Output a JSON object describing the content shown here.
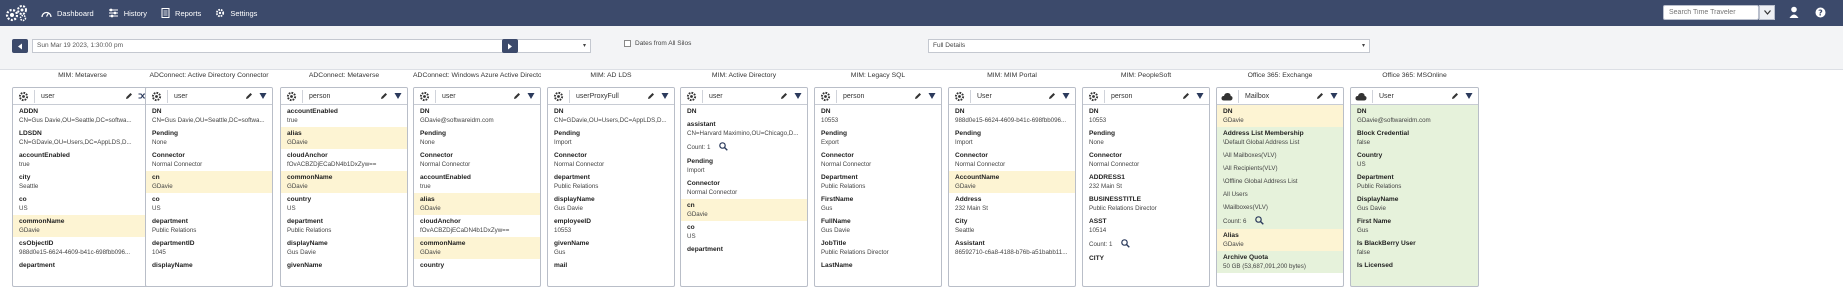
{
  "nav": {
    "dashboard": "Dashboard",
    "history": "History",
    "reports": "Reports",
    "settings": "Settings"
  },
  "search": {
    "placeholder": "Search Time Traveler"
  },
  "toolbar": {
    "date": "Sun Mar 19 2023, 1:30:00 pm",
    "dates_from_all_silos": "Dates from All Silos",
    "details_option": "Full Details"
  },
  "columns": [
    {
      "title": "MIM: Metaverse",
      "type": "user",
      "icon": "gear-icon",
      "attrs": [
        {
          "n": "ADDN",
          "v": "CN=Gus Davie,OU=Seattle,DC=softwa...",
          "hl": ""
        },
        {
          "n": "LDSDN",
          "v": "CN=GDavie,OU=Users,DC=AppLDS,D...",
          "hl": ""
        },
        {
          "n": "accountEnabled",
          "v": "true",
          "hl": ""
        },
        {
          "n": "city",
          "v": "Seattle",
          "hl": ""
        },
        {
          "n": "co",
          "v": "US",
          "hl": ""
        },
        {
          "n": "commonName",
          "v": "GDavie",
          "hl": "hl"
        },
        {
          "n": "csObjectID",
          "v": "988d0e15-6624-4609-b41c-698fbb096...",
          "hl": ""
        },
        {
          "n": "department",
          "v": "",
          "hl": ""
        }
      ]
    },
    {
      "title": "ADConnect: Active Directory Connector",
      "type": "user",
      "icon": "gear-icon",
      "attrs": [
        {
          "n": "DN",
          "v": "CN=Gus Davie,OU=Seattle,DC=softwa...",
          "hl": ""
        },
        {
          "n": "Pending",
          "v": "None",
          "hl": ""
        },
        {
          "n": "Connector",
          "v": "Normal Connector",
          "hl": ""
        },
        {
          "n": "cn",
          "v": "GDavie",
          "hl": "hl"
        },
        {
          "n": "co",
          "v": "US",
          "hl": ""
        },
        {
          "n": "department",
          "v": "Public Relations",
          "hl": ""
        },
        {
          "n": "departmentID",
          "v": "1045",
          "hl": ""
        },
        {
          "n": "displayName",
          "v": "",
          "hl": ""
        }
      ]
    },
    {
      "title": "ADConnect: Metaverse",
      "type": "person",
      "icon": "gear-icon",
      "attrs": [
        {
          "n": "accountEnabled",
          "v": "true",
          "hl": ""
        },
        {
          "n": "alias",
          "v": "GDavie",
          "hl": "hl"
        },
        {
          "n": "cloudAnchor",
          "v": "fOvACBZDjECaDN4b1DxZyw==",
          "hl": ""
        },
        {
          "n": "commonName",
          "v": "GDavie",
          "hl": "hl"
        },
        {
          "n": "country",
          "v": "US",
          "hl": ""
        },
        {
          "n": "department",
          "v": "Public Relations",
          "hl": ""
        },
        {
          "n": "displayName",
          "v": "Gus Davie",
          "hl": ""
        },
        {
          "n": "givenName",
          "v": "",
          "hl": ""
        }
      ]
    },
    {
      "title": "ADConnect: Windows Azure Active Director...",
      "type": "user",
      "icon": "gear-icon",
      "attrs": [
        {
          "n": "DN",
          "v": "GDavie@softwareidm.com",
          "hl": ""
        },
        {
          "n": "Pending",
          "v": "None",
          "hl": ""
        },
        {
          "n": "Connector",
          "v": "Normal Connector",
          "hl": ""
        },
        {
          "n": "accountEnabled",
          "v": "true",
          "hl": ""
        },
        {
          "n": "alias",
          "v": "GDavie",
          "hl": "hl"
        },
        {
          "n": "cloudAnchor",
          "v": "fOvACBZDjECaDN4b1DxZyw==",
          "hl": ""
        },
        {
          "n": "commonName",
          "v": "GDavie",
          "hl": "hl"
        },
        {
          "n": "country",
          "v": "",
          "hl": ""
        }
      ]
    },
    {
      "title": "MIM: AD LDS",
      "type": "userProxyFull",
      "icon": "gear-icon",
      "attrs": [
        {
          "n": "DN",
          "v": "CN=GDavie,OU=Users,DC=AppLDS,D...",
          "hl": ""
        },
        {
          "n": "Pending",
          "v": "Import",
          "hl": ""
        },
        {
          "n": "Connector",
          "v": "Normal Connector",
          "hl": ""
        },
        {
          "n": "department",
          "v": "Public Relations",
          "hl": ""
        },
        {
          "n": "displayName",
          "v": "Gus Davie",
          "hl": ""
        },
        {
          "n": "employeeID",
          "v": "10553",
          "hl": ""
        },
        {
          "n": "givenName",
          "v": "Gus",
          "hl": ""
        },
        {
          "n": "mail",
          "v": "",
          "hl": ""
        }
      ]
    },
    {
      "title": "MIM: Active Directory",
      "type": "user",
      "icon": "gear-icon",
      "attrs": [
        {
          "n": "DN",
          "v": "",
          "hl": ""
        },
        {
          "n": "assistant",
          "v": "CN=Harvard Maximino,OU=Chicago,D...",
          "hl": ""
        },
        {
          "n": "Count: 1",
          "v": "",
          "hl": "count"
        },
        {
          "n": "Pending",
          "v": "Import",
          "hl": ""
        },
        {
          "n": "Connector",
          "v": "Normal Connector",
          "hl": ""
        },
        {
          "n": "cn",
          "v": "GDavie",
          "hl": "hl"
        },
        {
          "n": "co",
          "v": "US",
          "hl": ""
        },
        {
          "n": "department",
          "v": "",
          "hl": ""
        }
      ]
    },
    {
      "title": "MIM: Legacy SQL",
      "type": "person",
      "icon": "gear-icon",
      "attrs": [
        {
          "n": "DN",
          "v": "10553",
          "hl": ""
        },
        {
          "n": "Pending",
          "v": "Export",
          "hl": ""
        },
        {
          "n": "Connector",
          "v": "Normal Connector",
          "hl": ""
        },
        {
          "n": "Department",
          "v": "Public Relations",
          "hl": ""
        },
        {
          "n": "FirstName",
          "v": "Gus",
          "hl": ""
        },
        {
          "n": "FullName",
          "v": "Gus Davie",
          "hl": ""
        },
        {
          "n": "JobTitle",
          "v": "Public Relations Director",
          "hl": ""
        },
        {
          "n": "LastName",
          "v": "",
          "hl": ""
        }
      ]
    },
    {
      "title": "MIM: MIM Portal",
      "type": "User",
      "icon": "gear-icon",
      "attrs": [
        {
          "n": "DN",
          "v": "988d0e15-6624-4609-b41c-698fbb096...",
          "hl": ""
        },
        {
          "n": "Pending",
          "v": "Import",
          "hl": ""
        },
        {
          "n": "Connector",
          "v": "Normal Connector",
          "hl": ""
        },
        {
          "n": "AccountName",
          "v": "GDavie",
          "hl": "hl"
        },
        {
          "n": "Address",
          "v": "232 Main St",
          "hl": ""
        },
        {
          "n": "City",
          "v": "Seattle",
          "hl": ""
        },
        {
          "n": "Assistant",
          "v": "86592710-c6a8-4188-b76b-a51babb11...",
          "hl": ""
        },
        {
          "n": "",
          "v": "",
          "hl": ""
        }
      ]
    },
    {
      "title": "MIM: PeopleSoft",
      "type": "person",
      "icon": "gear-icon",
      "attrs": [
        {
          "n": "DN",
          "v": "10553",
          "hl": ""
        },
        {
          "n": "Pending",
          "v": "None",
          "hl": ""
        },
        {
          "n": "Connector",
          "v": "Normal Connector",
          "hl": ""
        },
        {
          "n": "ADDRESS1",
          "v": "232 Main St",
          "hl": ""
        },
        {
          "n": "BUSINESSTITLE",
          "v": "Public Relations Director",
          "hl": ""
        },
        {
          "n": "ASST",
          "v": "10514",
          "hl": ""
        },
        {
          "n": "Count: 1",
          "v": "",
          "hl": "count"
        },
        {
          "n": "CITY",
          "v": "",
          "hl": ""
        }
      ]
    },
    {
      "title": "Office 365: Exchange",
      "type": "Mailbox",
      "icon": "cloud-icon",
      "attrs": [
        {
          "n": "DN",
          "v": "GDavie",
          "hl": "hl"
        },
        {
          "n": "Address List Membership",
          "v": "\\Default Global Address List",
          "hl": "gr"
        },
        {
          "n": "",
          "v": "\\All Mailboxes(VLV)",
          "hl": "gr"
        },
        {
          "n": "",
          "v": "\\All Recipients(VLV)",
          "hl": "gr"
        },
        {
          "n": "",
          "v": "\\Offline Global Address List",
          "hl": "gr"
        },
        {
          "n": "",
          "v": "All Users",
          "hl": "gr"
        },
        {
          "n": "",
          "v": "\\Mailboxes(VLV)",
          "hl": "gr"
        },
        {
          "n": "Count: 6",
          "v": "",
          "hl": "count-gr"
        },
        {
          "n": "Alias",
          "v": "GDavie",
          "hl": "hl"
        },
        {
          "n": "Archive Quota",
          "v": "50 GB (53,687,091,200 bytes)",
          "hl": "gr"
        }
      ]
    },
    {
      "title": "Office 365: MSOnline",
      "type": "User",
      "icon": "cloud-icon",
      "attrs": [
        {
          "n": "DN",
          "v": "GDavie@softwareidm.com",
          "hl": "gr"
        },
        {
          "n": "Block Credential",
          "v": "false",
          "hl": "gr"
        },
        {
          "n": "Country",
          "v": "US",
          "hl": "gr"
        },
        {
          "n": "Department",
          "v": "Public Relations",
          "hl": "gr"
        },
        {
          "n": "DisplayName",
          "v": "Gus Davie",
          "hl": "gr"
        },
        {
          "n": "First Name",
          "v": "Gus",
          "hl": "gr"
        },
        {
          "n": "Is BlackBerry User",
          "v": "false",
          "hl": "gr"
        },
        {
          "n": "Is Licensed",
          "v": "",
          "hl": "gr"
        }
      ]
    }
  ]
}
